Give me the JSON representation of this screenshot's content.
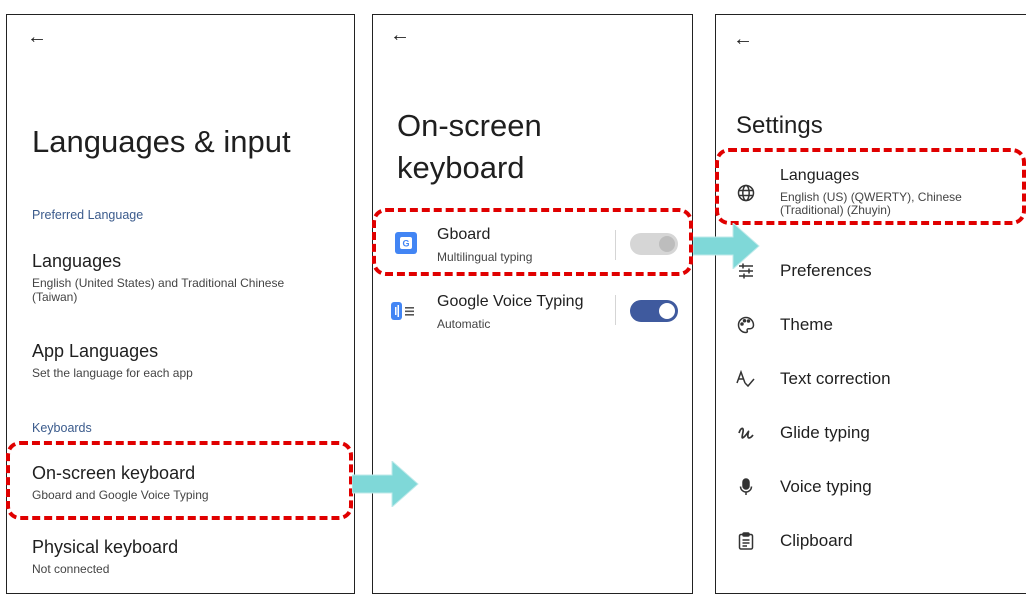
{
  "panel1": {
    "back_glyph": "←",
    "title": "Languages & input",
    "section_preferred": "Preferred Language",
    "languages_title": "Languages",
    "languages_sub": "English (United States) and Traditional Chinese (Taiwan)",
    "app_languages_title": "App Languages",
    "app_languages_sub": "Set the language for each app",
    "section_keyboards": "Keyboards",
    "onscreen_title": "On-screen keyboard",
    "onscreen_sub": "Gboard and Google Voice Typing",
    "physical_title": "Physical keyboard",
    "physical_sub": "Not connected"
  },
  "panel2": {
    "back_glyph": "←",
    "title_line1": "On-screen",
    "title_line2": "keyboard",
    "gboard_title": "Gboard",
    "gboard_sub": "Multilingual typing",
    "gboard_enabled": true,
    "gboard_toggle_disabled": true,
    "voice_title": "Google Voice Typing",
    "voice_sub": "Automatic",
    "voice_enabled": true
  },
  "panel3": {
    "back_glyph": "←",
    "title": "Settings",
    "languages_title": "Languages",
    "languages_sub_line1": "English (US) (QWERTY), Chinese",
    "languages_sub_line2": "(Traditional) (Zhuyin)",
    "items": [
      {
        "label": "Preferences",
        "icon": "sliders-icon"
      },
      {
        "label": "Theme",
        "icon": "palette-icon"
      },
      {
        "label": "Text correction",
        "icon": "text-correction-icon"
      },
      {
        "label": "Glide typing",
        "icon": "glide-icon"
      },
      {
        "label": "Voice typing",
        "icon": "mic-icon"
      },
      {
        "label": "Clipboard",
        "icon": "clipboard-icon"
      }
    ]
  },
  "colors": {
    "highlight": "#e00000",
    "arrow": "#7fd8d8",
    "section_text": "#3b5b8c",
    "toggle_on": "#3f5a9e",
    "toggle_disabled": "#cfcfcf"
  }
}
